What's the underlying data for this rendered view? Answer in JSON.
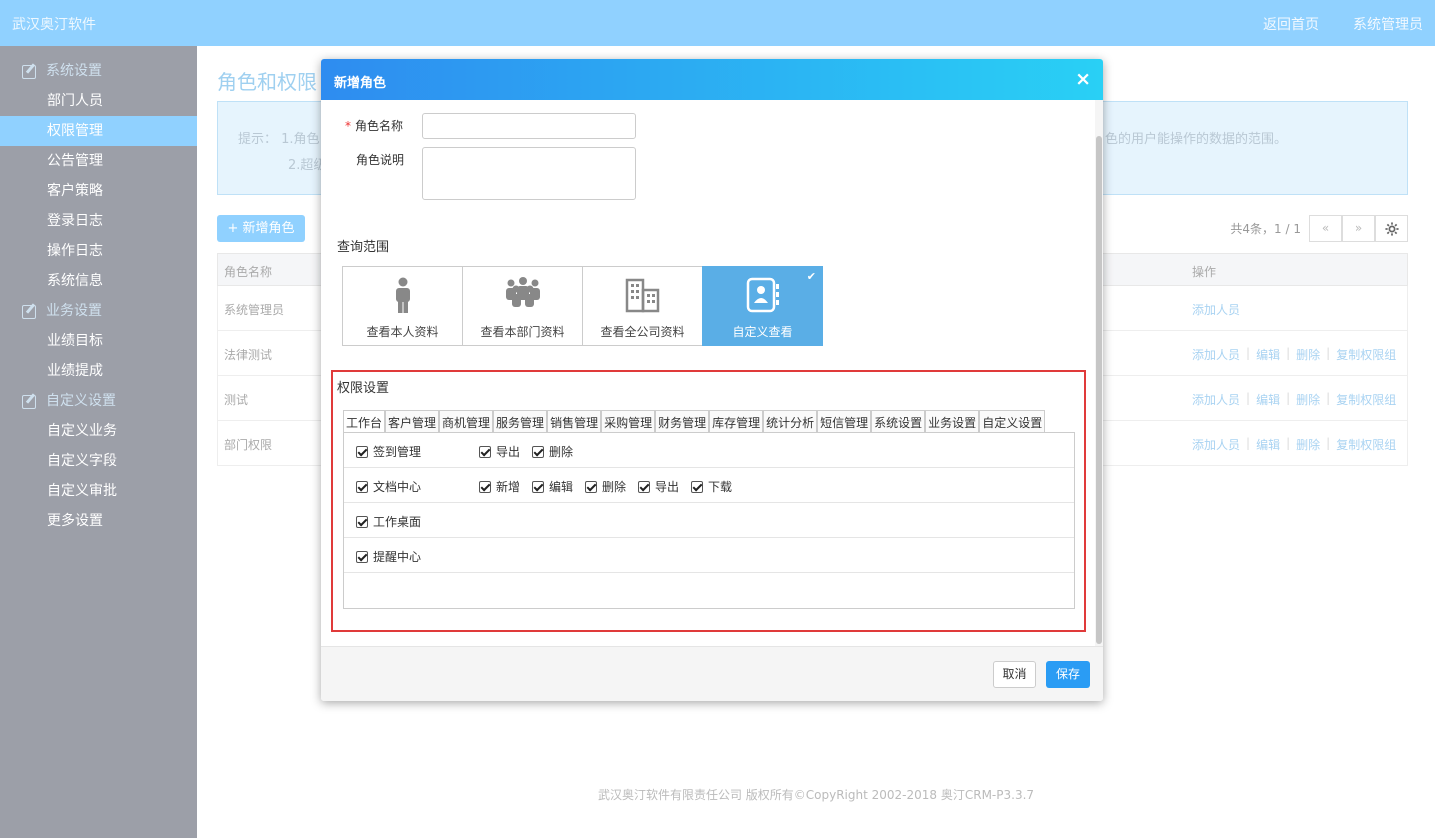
{
  "topbar": {
    "brand": "武汉奥汀软件",
    "nav_home": "返回首页",
    "nav_admin": "系统管理员"
  },
  "sidebar": {
    "group_system": "系统设置",
    "system_items": [
      "部门人员",
      "权限管理",
      "公告管理",
      "客户策略",
      "登录日志",
      "操作日志",
      "系统信息"
    ],
    "group_business": "业务设置",
    "business_items": [
      "业绩目标",
      "业绩提成"
    ],
    "group_custom": "自定义设置",
    "custom_items": [
      "自定义业务",
      "自定义字段",
      "自定义审批",
      "更多设置"
    ],
    "active": "权限管理"
  },
  "main": {
    "page_title": "角色和权限",
    "tip_label": "提示：",
    "tip_line1": "1.角色",
    "tip_line1_end": "色的用户能操作的数据的范围。",
    "tip_line2": "2.超级",
    "add_role": "+ 新增角色",
    "pager_count": "共4条，1 / 1",
    "pager_prev": "«",
    "pager_next": "»",
    "col_name": "角色名称",
    "col_ops": "操作",
    "rows": [
      {
        "name": "系统管理员",
        "ops": [
          "添加人员"
        ]
      },
      {
        "name": "法律测试",
        "ops": [
          "添加人员",
          "编辑",
          "删除",
          "复制权限组"
        ]
      },
      {
        "name": "测试",
        "ops": [
          "添加人员",
          "编辑",
          "删除",
          "复制权限组"
        ]
      },
      {
        "name": "部门权限",
        "ops": [
          "添加人员",
          "编辑",
          "删除",
          "复制权限组"
        ]
      }
    ],
    "footer": "武汉奥汀软件有限责任公司 版权所有©CopyRight 2002-2018 奥汀CRM-P3.3.7"
  },
  "modal": {
    "title": "新增角色",
    "close": "×",
    "role_name_label": "角色名称",
    "required_mark": "*",
    "role_name_value": "",
    "role_desc_label": "角色说明",
    "role_desc_value": "",
    "scope_title": "查询范围",
    "scopes": [
      {
        "label": "查看本人资料",
        "icon": "person-icon",
        "selected": false
      },
      {
        "label": "查看本部门资料",
        "icon": "group-icon",
        "selected": false
      },
      {
        "label": "查看全公司资料",
        "icon": "building-icon",
        "selected": false
      },
      {
        "label": "自定义查看",
        "icon": "contact-book-icon",
        "selected": true
      }
    ],
    "scope_check": "✔",
    "perm_title": "权限设置",
    "tabs": [
      "工作台",
      "客户管理",
      "商机管理",
      "服务管理",
      "销售管理",
      "采购管理",
      "财务管理",
      "库存管理",
      "统计分析",
      "短信管理",
      "系统设置",
      "业务设置",
      "自定义设置"
    ],
    "active_tab": "工作台",
    "perm_rows": [
      {
        "name": "签到管理",
        "subs": [
          "导出",
          "删除"
        ]
      },
      {
        "name": "文档中心",
        "subs": [
          "新增",
          "编辑",
          "删除",
          "导出",
          "下载"
        ]
      },
      {
        "name": "工作桌面",
        "subs": []
      },
      {
        "name": "提醒中心",
        "subs": []
      }
    ],
    "cancel": "取消",
    "save": "保存"
  },
  "colors": {
    "topbar": "#90d1ff",
    "sidebar": "#9c9fa8",
    "accent": "#2a9cf4",
    "selected_scope": "#5aaee6",
    "highlight_border": "#e03a3a"
  }
}
